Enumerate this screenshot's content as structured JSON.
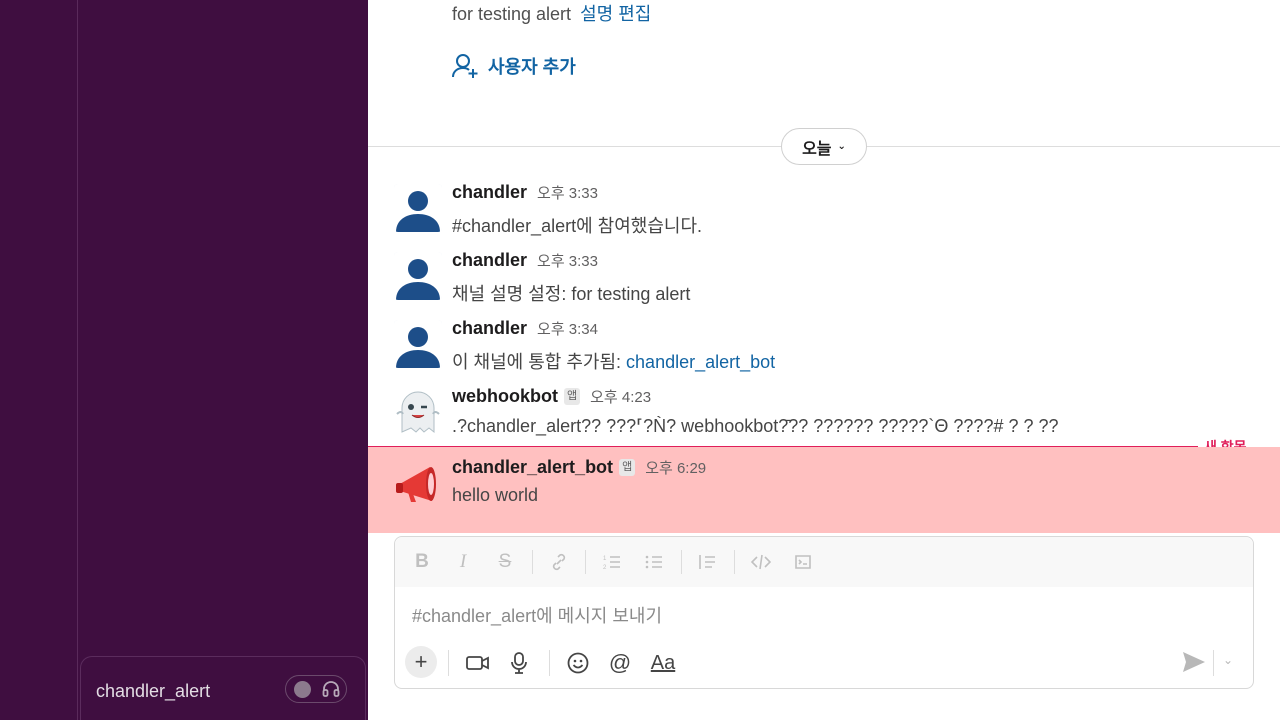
{
  "channel": {
    "description_text": "for testing alert",
    "edit_description_label": "설명 편집",
    "add_user_label": "사용자 추가"
  },
  "day_divider": {
    "label": "오늘"
  },
  "messages": [
    {
      "author": "chandler",
      "time": "오후 3:33",
      "text": "#chandler_alert에 참여했습니다."
    },
    {
      "author": "chandler",
      "time": "오후 3:33",
      "text": "채널 설명 설정: for testing alert"
    },
    {
      "author": "chandler",
      "time": "오후 3:34",
      "text_prefix": "이 채널에 통합 추가됨: ",
      "link": "chandler_alert_bot"
    },
    {
      "author": "webhookbot",
      "badge": "앱",
      "time": "오후 4:23",
      "text": ".?chandler_alert?? ???⸢?Ǹ? webhookbot?̄?? ?????? ?????`Θ ????# ?    ? ??"
    },
    {
      "author": "chandler_alert_bot",
      "badge": "앱",
      "time": "오후 6:29",
      "text": "hello world"
    }
  ],
  "new_items_label": "새 항목",
  "composer": {
    "placeholder": "#chandler_alert에 메시지 보내기",
    "format_label": "Aa"
  },
  "sidebar": {
    "huddle_channel": "chandler_alert"
  },
  "colors": {
    "sidebar_bg": "#3f0e40",
    "link": "#1264a3",
    "new_marker": "#e01e5a",
    "highlight_bg": "#ffc0c0"
  }
}
